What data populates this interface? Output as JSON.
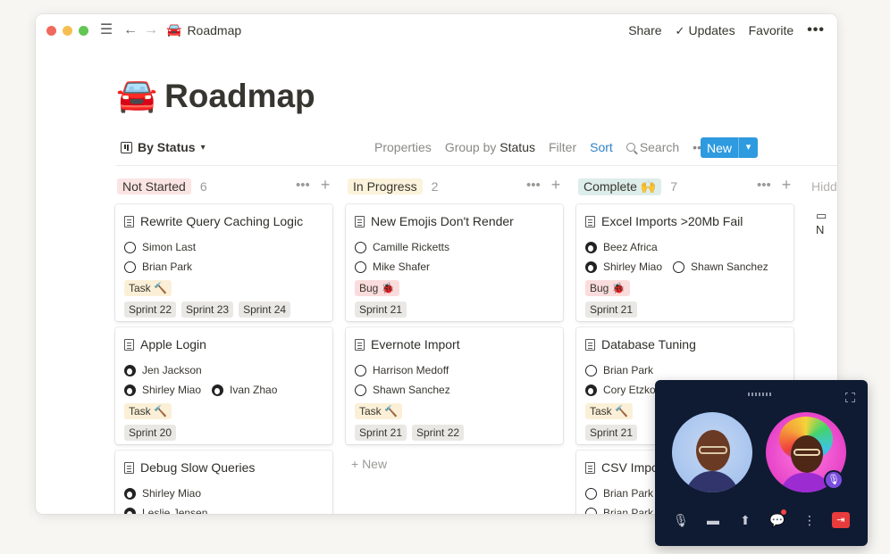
{
  "topbar": {
    "crumb_emoji": "🚘",
    "crumb_title": "Roadmap",
    "share": "Share",
    "updates": "Updates",
    "favorite": "Favorite",
    "more": "•••"
  },
  "page": {
    "emoji": "🚘",
    "title": "Roadmap"
  },
  "toolbar": {
    "view": "By Status",
    "properties": "Properties",
    "group_by": "Group by",
    "group_by_value": "Status",
    "filter": "Filter",
    "sort": "Sort",
    "search": "Search",
    "more": "•••",
    "new": "New"
  },
  "columns": [
    {
      "name": "Not Started",
      "count": "6",
      "color": "#fbe4e4"
    },
    {
      "name": "In Progress",
      "count": "2",
      "color": "#fbf3db"
    },
    {
      "name": "Complete 🙌",
      "count": "7",
      "color": "#ddedea"
    }
  ],
  "hidden_col": "Hidde",
  "hidden_item": "N",
  "column_actions": {
    "more": "•••",
    "add": "+"
  },
  "cards": [
    {
      "title": "Rewrite Query Caching Logic",
      "people": [
        [
          "Simon Last"
        ],
        [
          "Brian Park"
        ]
      ],
      "type": "Task 🔨",
      "sprints": [
        "Sprint 22",
        "Sprint 23",
        "Sprint 24"
      ]
    },
    {
      "title": "Apple Login",
      "people": [
        [
          "Jen Jackson"
        ],
        [
          "Shirley Miao",
          "Ivan Zhao"
        ]
      ],
      "type": "Task 🔨",
      "sprints": [
        "Sprint 20"
      ]
    },
    {
      "title": "Debug Slow Queries",
      "people": [
        [
          "Shirley Miao"
        ],
        [
          "Leslie Jensen"
        ]
      ]
    },
    {
      "title": "New Emojis Don't Render",
      "people": [
        [
          "Camille Ricketts"
        ],
        [
          "Mike Shafer"
        ]
      ],
      "type": "Bug 🐞",
      "sprints": [
        "Sprint 21"
      ]
    },
    {
      "title": "Evernote Import",
      "people": [
        [
          "Harrison Medoff"
        ],
        [
          "Shawn Sanchez"
        ]
      ],
      "type": "Task 🔨",
      "sprints": [
        "Sprint 21",
        "Sprint 22"
      ]
    },
    {
      "title": "Excel Imports >20Mb Fail",
      "people": [
        [
          "Beez Africa"
        ],
        [
          "Shirley Miao",
          "Shawn Sanchez"
        ]
      ],
      "type": "Bug 🐞",
      "sprints": [
        "Sprint 21"
      ]
    },
    {
      "title": "Database Tuning",
      "people": [
        [
          "Brian Park"
        ],
        [
          "Cory Etzko"
        ]
      ],
      "type": "Task 🔨",
      "sprints": [
        "Sprint 21"
      ]
    },
    {
      "title": "CSV Impo",
      "people": [
        [
          "Brian Park"
        ],
        [
          "Brian Park"
        ]
      ]
    }
  ],
  "new_row": "+ New",
  "call": {
    "controls": [
      "mic-icon",
      "camera-icon",
      "screen-share-icon",
      "chat-icon",
      "more-icon",
      "leave-icon"
    ]
  }
}
